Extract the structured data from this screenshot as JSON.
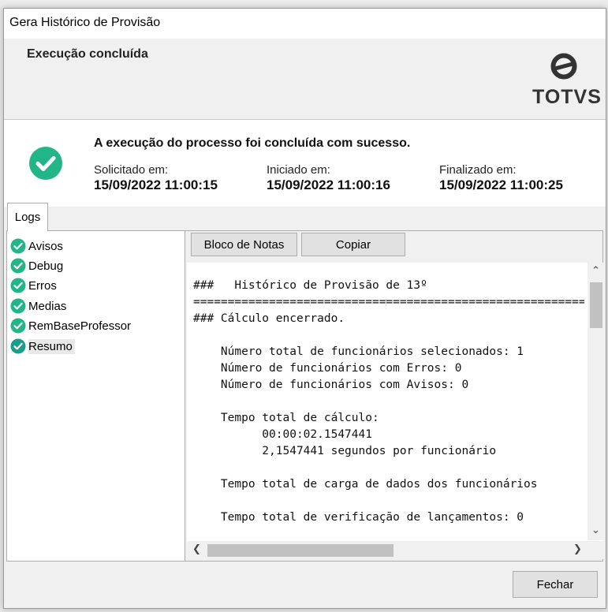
{
  "window": {
    "title": "Gera Histórico de Provisão"
  },
  "header": {
    "title": "Execução concluída",
    "logo_text": "TOTVS"
  },
  "status": {
    "message": "A execução do processo foi concluída com sucesso.",
    "solicitado_label": "Solicitado em:",
    "solicitado_value": "15/09/2022 11:00:15",
    "iniciado_label": "Iniciado em:",
    "iniciado_value": "15/09/2022 11:00:16",
    "finalizado_label": "Finalizado em:",
    "finalizado_value": "15/09/2022 11:00:25"
  },
  "tabs": [
    {
      "label": "Logs",
      "active": true
    }
  ],
  "log_tree": {
    "items": [
      {
        "label": "Avisos",
        "icon": "check-circle-icon"
      },
      {
        "label": "Debug",
        "icon": "check-circle-icon"
      },
      {
        "label": "Erros",
        "icon": "check-circle-icon"
      },
      {
        "label": "Medias",
        "icon": "check-circle-icon"
      },
      {
        "label": "RemBaseProfessor",
        "icon": "check-circle-icon"
      },
      {
        "label": "Resumo",
        "icon": "check-circle-icon",
        "selected": true
      }
    ]
  },
  "toolbar": {
    "bloco_label": "Bloco de Notas",
    "copiar_label": "Copiar"
  },
  "log_content": "###   Histórico de Provisão de 13º\n=================================================================\n### Cálculo encerrado.\n\n    Número total de funcionários selecionados: 1\n    Número de funcionários com Erros: 0\n    Número de funcionários com Avisos: 0\n\n    Tempo total de cálculo:\n          00:00:02.1547441\n          2,1547441 segundos por funcionário\n\n    Tempo total de carga de dados dos funcionários\n\n    Tempo total de verificação de lançamentos: 0",
  "footer": {
    "close_label": "Fechar"
  },
  "colors": {
    "success": "#21b587",
    "check_dark": "#1a9d8a"
  }
}
